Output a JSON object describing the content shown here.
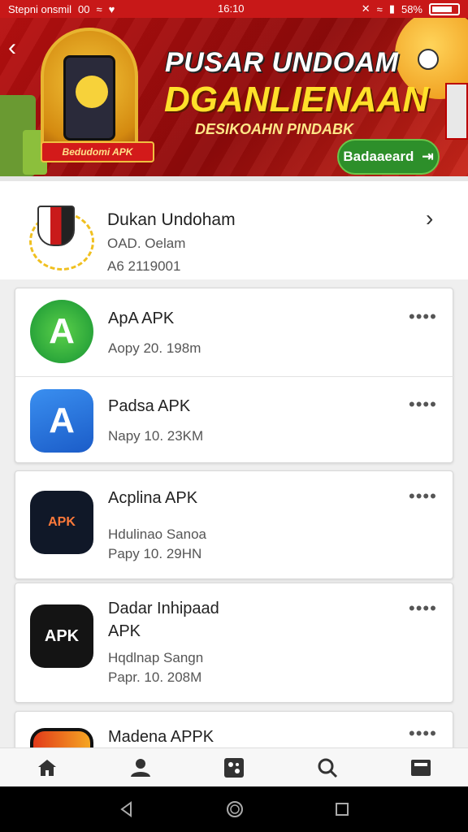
{
  "status_bar": {
    "left_text": "Stepni onsmil",
    "left_extra": "00",
    "time": "16:10",
    "battery_text": "58%"
  },
  "banner": {
    "title_line1": "PUSAR UNDOAM",
    "title_line2": "DGANLIENAAN",
    "subtitle": "DESIKOAHN PINDABK",
    "ribbon": "Bedudomi APK",
    "download_label": "Badaaeard"
  },
  "featured": {
    "title": "Dukan Undoham",
    "line1": "OAD. Oelam",
    "line2": "A6 2119001"
  },
  "apps": [
    {
      "name": "ApA APK",
      "meta1": "Aopy 20. 198m",
      "icon": "green-a-icon",
      "glyph": "A"
    },
    {
      "name": "Padsa APK",
      "meta1": "Napy 10. 23KM",
      "icon": "blue-a-icon",
      "glyph": "A"
    },
    {
      "name": "Acplina APK",
      "meta1": "Hdulinao Sanoa",
      "meta2": "Papy 10. 29HN",
      "icon": "orange-x-icon",
      "glyph": "APK"
    },
    {
      "name": "Dadar Inhipaad",
      "name2": "APK",
      "meta1": "Hqdlnap Sangn",
      "meta2": "Papr. 10. 208M",
      "icon": "pen-apk-icon",
      "glyph": "APK"
    },
    {
      "name": "Madena APPK",
      "icon": "red-app-icon"
    }
  ],
  "more_label": "••••",
  "bottom_nav": [
    {
      "icon": "home-icon"
    },
    {
      "icon": "profile-icon"
    },
    {
      "icon": "apps-icon"
    },
    {
      "icon": "search-icon"
    },
    {
      "icon": "downloads-icon"
    }
  ]
}
